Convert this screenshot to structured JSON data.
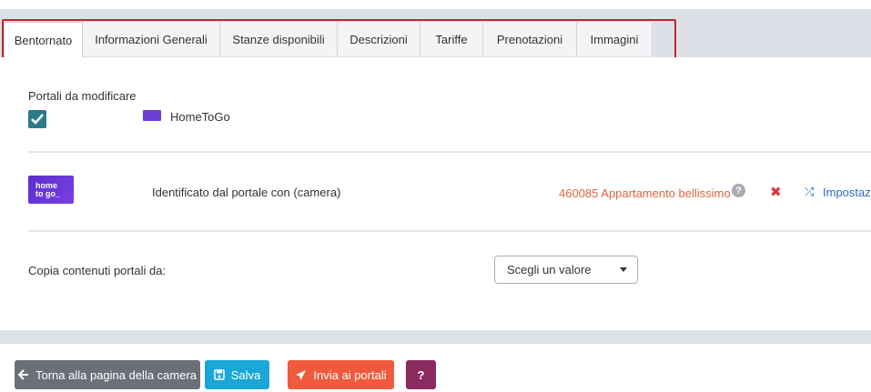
{
  "tabs": [
    {
      "label": "Bentornato",
      "active": true
    },
    {
      "label": "Informazioni Generali",
      "active": false
    },
    {
      "label": "Stanze disponibili",
      "active": false
    },
    {
      "label": "Descrizioni",
      "active": false
    },
    {
      "label": "Tariffe",
      "active": false
    },
    {
      "label": "Prenotazioni",
      "active": false
    },
    {
      "label": "Immagini",
      "active": false
    }
  ],
  "portals": {
    "section_label": "Portali da modificare",
    "checked": true,
    "portal_name": "HomeToGo",
    "logo_text_line1": "home",
    "logo_text_line2": "to go_"
  },
  "mapping": {
    "identified_label": "Identificato dal portale con (camera)",
    "room_link": "460085 Appartamento bellissimo",
    "help_icon": "?",
    "settings_label": "Impostazi"
  },
  "copy": {
    "label": "Copia contenuti portali da:",
    "select_value": "Scegli un valore"
  },
  "buttons": {
    "back": "Torna alla pagina della camera",
    "save": "Salva",
    "send": "Invia ai portali",
    "help": "?"
  },
  "colors": {
    "accent_teal": "#2a7a8a",
    "danger_red": "#d9363e",
    "link_orange": "#e0633f",
    "link_blue": "#2a6ebb",
    "highlight_frame": "#c0262d",
    "homtogo_purple": "#6a3fd0"
  }
}
